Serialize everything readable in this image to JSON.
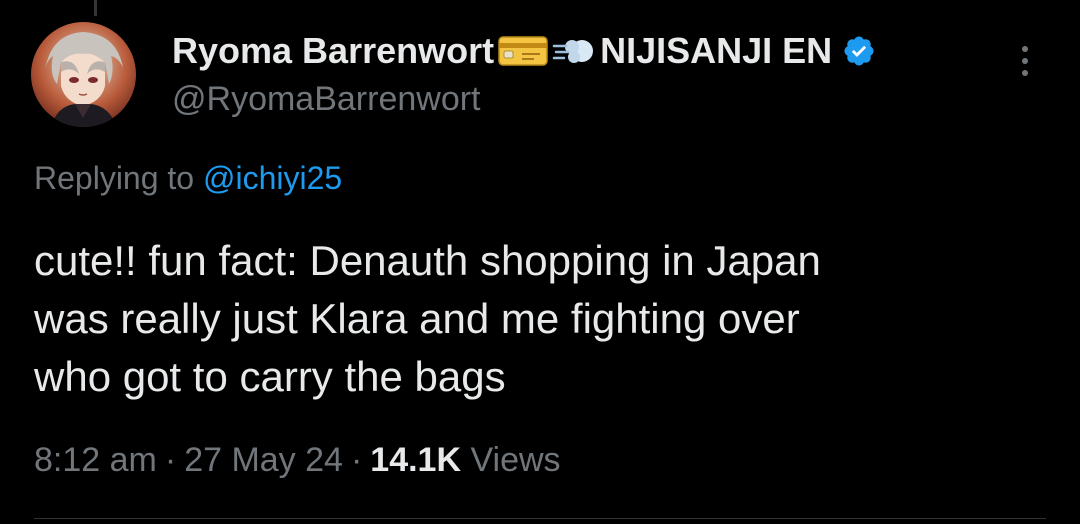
{
  "tweet": {
    "author": {
      "display_name": "Ryoma Barrenwort",
      "name_emojis": [
        "credit-card-emoji",
        "dashing-away-emoji"
      ],
      "affiliation": "NIJISANJI EN",
      "verified_icon": "verified-badge-icon",
      "handle": "@RyomaBarrenwort"
    },
    "replying_prefix": "Replying to",
    "replying_to_handle": "@ichiyi25",
    "text": "cute!! fun fact: Denauth shopping in Japan\nwas really just Klara and me fighting over\nwho got to carry the bags",
    "time": "8:12 am",
    "separator": "·",
    "date": "27 May 24",
    "views_count": "14.1K",
    "views_label": "Views"
  },
  "colors": {
    "background": "#000000",
    "primary_text": "#e7e9ea",
    "secondary_text": "#71767b",
    "link": "#1d9bf0",
    "verified": "#1d9bf0"
  }
}
